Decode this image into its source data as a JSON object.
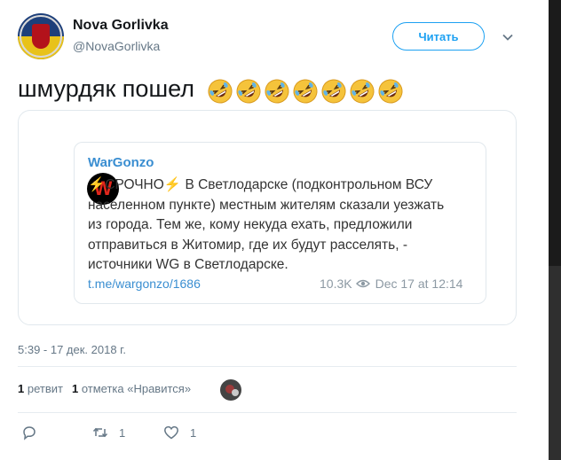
{
  "author": {
    "name": "Nova Gorlivka",
    "handle": "@NovaGorlivka"
  },
  "follow_label": "Читать",
  "tweet": {
    "text": "шмурдяк пошел",
    "emoji_count": 7
  },
  "embed": {
    "logo_letter": "W",
    "channel": "WarGonzo",
    "bolt": "⚡",
    "urgent": "СРОЧНО",
    "body": "В Светлодарске (подконтрольном ВСУ населенном пункте) местным жителям сказали уезжать из города. Тем же, кому некуда ехать, предложили отправиться в Житомир, где их будут расселять, - источники WG в Светлодарске.",
    "link": "t.me/wargonzo/1686",
    "views": "10.3K",
    "date": "Dec 17 at 12:14"
  },
  "timestamp": "5:39 - 17 дек. 2018 г.",
  "stats": {
    "retweets_count": "1",
    "retweets_label": "ретвит",
    "likes_count": "1",
    "likes_label": "отметка «Нравится»"
  },
  "actions": {
    "reply_count": "",
    "retweet_count": "1",
    "like_count": "1"
  },
  "colors": {
    "accent": "#1da1f2",
    "telegram_link": "#3a8ed1",
    "emoji_yellow": "#f5c33b"
  }
}
